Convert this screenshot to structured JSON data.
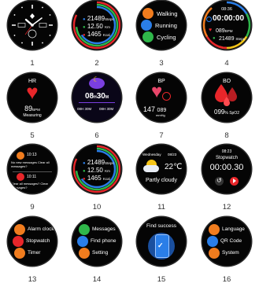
{
  "screens": [
    {
      "number": "1",
      "name": "Analog watch face"
    },
    {
      "number": "2",
      "name": "Activity rings",
      "steps": "21489",
      "steps_unit": "Steps",
      "distance": "12.50",
      "distance_unit": "Km",
      "calories": "1465",
      "calories_unit": "Kcal"
    },
    {
      "number": "3",
      "name": "Sport modes",
      "items": [
        "Walking",
        "Running",
        "Cycling"
      ]
    },
    {
      "number": "4",
      "name": "Timer face",
      "time": "08:36",
      "counter": "00:00:00",
      "bpm": "089",
      "bpm_unit": "BPM",
      "steps": "21489",
      "steps_unit": "Steps"
    },
    {
      "number": "5",
      "name": "Heart rate",
      "title": "HR",
      "value": "89",
      "unit": "BPM",
      "status": "Measuring"
    },
    {
      "number": "6",
      "name": "Sleep",
      "hours": "08",
      "h_unit": "H",
      "minutes": "30",
      "m_unit": "M",
      "left_stat": "08H 30M",
      "right_stat": "08H 30M"
    },
    {
      "number": "7",
      "name": "Blood pressure",
      "title": "BP",
      "systolic": "147",
      "diastolic": "089",
      "unit": "mmHg"
    },
    {
      "number": "8",
      "name": "Blood oxygen",
      "title": "BO",
      "value": "099",
      "unit": "% SpO2"
    },
    {
      "number": "9",
      "name": "Messages",
      "time1": "10:13",
      "msg1": "No new messages  Clear all messages?",
      "time2": "10:11",
      "msg2": "Clear all messages?  Clear messages?"
    },
    {
      "number": "10",
      "name": "Activity rings 2",
      "steps": "21489",
      "steps_unit": "Steps",
      "distance": "12.50",
      "distance_unit": "Km",
      "calories": "1465",
      "calories_unit": "Kcal"
    },
    {
      "number": "11",
      "name": "Weather",
      "day": "Wednesday",
      "date": "08/23",
      "temp": "22℃",
      "condition": "Partly cloudy"
    },
    {
      "number": "12",
      "name": "Stopwatch",
      "time": "08:23",
      "title": "Stopwatch",
      "value": "00:00.30"
    },
    {
      "number": "13",
      "name": "Tools menu",
      "items": [
        "Alarm clock",
        "Stopwatch",
        "Timer"
      ]
    },
    {
      "number": "14",
      "name": "Phone menu",
      "items": [
        "Messages",
        "Find phone",
        "Setting"
      ]
    },
    {
      "number": "15",
      "name": "Find phone",
      "title": "Find success"
    },
    {
      "number": "16",
      "name": "Settings menu",
      "items": [
        "Language",
        "QR Code",
        "System"
      ]
    }
  ],
  "colors": {
    "red": "#e8262a",
    "orange": "#f07c1e",
    "green": "#2fb74a",
    "blue": "#2a7ee8",
    "purple": "#7b3fe0",
    "bezel": "#2a2a2a"
  }
}
